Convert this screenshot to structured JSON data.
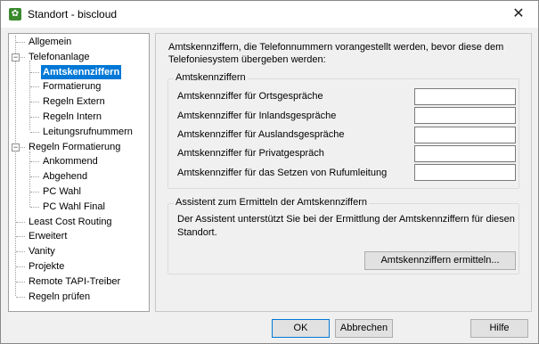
{
  "window": {
    "title": "Standort - biscloud",
    "close_glyph": "✕",
    "app_icon": "settings-gear-icon",
    "app_icon_glyph": "✿"
  },
  "tree": {
    "items": [
      {
        "label": "Allgemein"
      },
      {
        "label": "Telefonanlage",
        "expander": "−"
      },
      {
        "label": "Amtskennziffern",
        "selected": true
      },
      {
        "label": "Formatierung"
      },
      {
        "label": "Regeln Extern"
      },
      {
        "label": "Regeln Intern"
      },
      {
        "label": "Leitungsrufnummern"
      },
      {
        "label": "Regeln Formatierung",
        "expander": "−"
      },
      {
        "label": "Ankommend"
      },
      {
        "label": "Abgehend"
      },
      {
        "label": "PC Wahl"
      },
      {
        "label": "PC Wahl Final"
      },
      {
        "label": "Least Cost Routing"
      },
      {
        "label": "Erweitert"
      },
      {
        "label": "Vanity"
      },
      {
        "label": "Projekte"
      },
      {
        "label": "Remote TAPI-Treiber"
      },
      {
        "label": "Regeln prüfen"
      }
    ]
  },
  "content": {
    "description": "Amtskennziffern, die Telefonnummern vorangestellt werden, bevor diese dem Telefoniesystem übergeben werden:",
    "group1": {
      "title": "Amtskennziffern",
      "fields": [
        {
          "label": "Amtskennziffer für Ortsgespräche",
          "value": ""
        },
        {
          "label": "Amtskennziffer für Inlandsgespräche",
          "value": ""
        },
        {
          "label": "Amtskennziffer für Auslandsgespräche",
          "value": ""
        },
        {
          "label": "Amtskennziffer für Privatgespräch",
          "value": ""
        },
        {
          "label": "Amtskennziffer für das Setzen von Rufumleitung",
          "value": ""
        }
      ]
    },
    "group2": {
      "title": "Assistent zum Ermitteln der Amtskennziffern",
      "text": "Der Assistent unterstützt Sie bei der Ermittlung der Amtskennziffern für diesen Standort.",
      "button_label": "Amtskennziffern ermitteln..."
    }
  },
  "footer": {
    "ok_label": "OK",
    "cancel_label": "Abbrechen",
    "help_label": "Hilfe"
  },
  "colors": {
    "selection": "#0078d7",
    "app_icon": "#3a8a2e"
  }
}
